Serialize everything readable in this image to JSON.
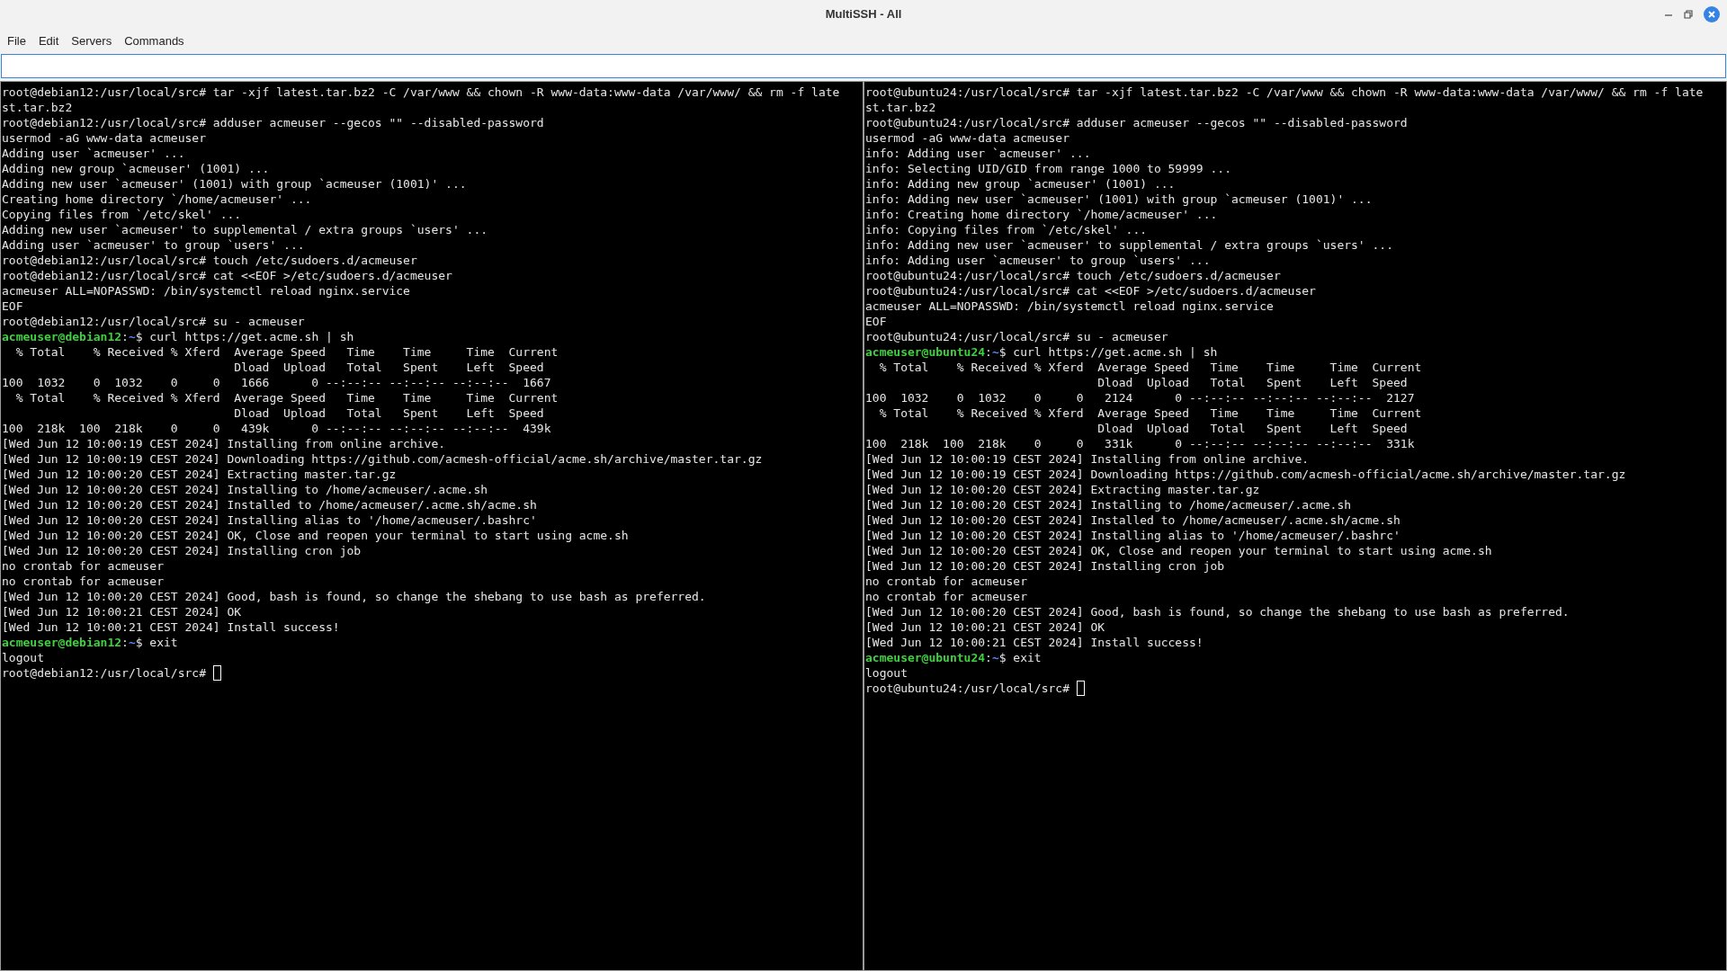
{
  "window": {
    "title": "MultiSSH - All"
  },
  "menu": [
    "File",
    "Edit",
    "Servers",
    "Commands"
  ],
  "command_input": {
    "focused": true
  },
  "panes": [
    {
      "lines": [
        {
          "kind": "output",
          "text": "root@debian12:/usr/local/src# tar -xjf latest.tar.bz2 -C /var/www && chown -R www-data:www-data /var/www/ && rm -f late"
        },
        {
          "kind": "output",
          "text": "st.tar.bz2"
        },
        {
          "kind": "output",
          "text": "root@debian12:/usr/local/src# adduser acmeuser --gecos \"\" --disabled-password"
        },
        {
          "kind": "output",
          "text": "usermod -aG www-data acmeuser"
        },
        {
          "kind": "output",
          "text": "Adding user `acmeuser' ..."
        },
        {
          "kind": "output",
          "text": "Adding new group `acmeuser' (1001) ..."
        },
        {
          "kind": "output",
          "text": "Adding new user `acmeuser' (1001) with group `acmeuser (1001)' ..."
        },
        {
          "kind": "output",
          "text": "Creating home directory `/home/acmeuser' ..."
        },
        {
          "kind": "output",
          "text": "Copying files from `/etc/skel' ..."
        },
        {
          "kind": "output",
          "text": "Adding new user `acmeuser' to supplemental / extra groups `users' ..."
        },
        {
          "kind": "output",
          "text": "Adding user `acmeuser' to group `users' ..."
        },
        {
          "kind": "output",
          "text": "root@debian12:/usr/local/src# touch /etc/sudoers.d/acmeuser"
        },
        {
          "kind": "output",
          "text": "root@debian12:/usr/local/src# cat <<EOF >/etc/sudoers.d/acmeuser"
        },
        {
          "kind": "output",
          "text": "acmeuser ALL=NOPASSWD: /bin/systemctl reload nginx.service"
        },
        {
          "kind": "output",
          "text": "EOF"
        },
        {
          "kind": "output",
          "text": "root@debian12:/usr/local/src# su - acmeuser"
        },
        {
          "kind": "user_prompt",
          "user": "acmeuser@debian12",
          "sep": ":",
          "path": "~",
          "command": "$ curl https://get.acme.sh | sh"
        },
        {
          "kind": "output",
          "text": "  % Total    % Received % Xferd  Average Speed   Time    Time     Time  Current"
        },
        {
          "kind": "output",
          "text": "                                 Dload  Upload   Total   Spent    Left  Speed"
        },
        {
          "kind": "output",
          "text": "100  1032    0  1032    0     0   1666      0 --:--:-- --:--:-- --:--:--  1667"
        },
        {
          "kind": "output",
          "text": "  % Total    % Received % Xferd  Average Speed   Time    Time     Time  Current"
        },
        {
          "kind": "output",
          "text": "                                 Dload  Upload   Total   Spent    Left  Speed"
        },
        {
          "kind": "output",
          "text": "100  218k  100  218k    0     0   439k      0 --:--:-- --:--:-- --:--:--  439k"
        },
        {
          "kind": "output",
          "text": "[Wed Jun 12 10:00:19 CEST 2024] Installing from online archive."
        },
        {
          "kind": "output",
          "text": "[Wed Jun 12 10:00:19 CEST 2024] Downloading https://github.com/acmesh-official/acme.sh/archive/master.tar.gz"
        },
        {
          "kind": "output",
          "text": "[Wed Jun 12 10:00:20 CEST 2024] Extracting master.tar.gz"
        },
        {
          "kind": "output",
          "text": "[Wed Jun 12 10:00:20 CEST 2024] Installing to /home/acmeuser/.acme.sh"
        },
        {
          "kind": "output",
          "text": "[Wed Jun 12 10:00:20 CEST 2024] Installed to /home/acmeuser/.acme.sh/acme.sh"
        },
        {
          "kind": "output",
          "text": "[Wed Jun 12 10:00:20 CEST 2024] Installing alias to '/home/acmeuser/.bashrc'"
        },
        {
          "kind": "output",
          "text": "[Wed Jun 12 10:00:20 CEST 2024] OK, Close and reopen your terminal to start using acme.sh"
        },
        {
          "kind": "output",
          "text": "[Wed Jun 12 10:00:20 CEST 2024] Installing cron job"
        },
        {
          "kind": "output",
          "text": "no crontab for acmeuser"
        },
        {
          "kind": "output",
          "text": "no crontab for acmeuser"
        },
        {
          "kind": "output",
          "text": "[Wed Jun 12 10:00:20 CEST 2024] Good, bash is found, so change the shebang to use bash as preferred."
        },
        {
          "kind": "output",
          "text": "[Wed Jun 12 10:00:21 CEST 2024] OK"
        },
        {
          "kind": "output",
          "text": "[Wed Jun 12 10:00:21 CEST 2024] Install success!"
        },
        {
          "kind": "user_prompt",
          "user": "acmeuser@debian12",
          "sep": ":",
          "path": "~",
          "command": "$ exit"
        },
        {
          "kind": "output",
          "text": "logout"
        },
        {
          "kind": "cursor_line",
          "text": "root@debian12:/usr/local/src# "
        }
      ]
    },
    {
      "lines": [
        {
          "kind": "output",
          "text": "root@ubuntu24:/usr/local/src# tar -xjf latest.tar.bz2 -C /var/www && chown -R www-data:www-data /var/www/ && rm -f late"
        },
        {
          "kind": "output",
          "text": "st.tar.bz2"
        },
        {
          "kind": "output",
          "text": "root@ubuntu24:/usr/local/src# adduser acmeuser --gecos \"\" --disabled-password"
        },
        {
          "kind": "output",
          "text": "usermod -aG www-data acmeuser"
        },
        {
          "kind": "output",
          "text": "info: Adding user `acmeuser' ..."
        },
        {
          "kind": "output",
          "text": "info: Selecting UID/GID from range 1000 to 59999 ..."
        },
        {
          "kind": "output",
          "text": "info: Adding new group `acmeuser' (1001) ..."
        },
        {
          "kind": "output",
          "text": "info: Adding new user `acmeuser' (1001) with group `acmeuser (1001)' ..."
        },
        {
          "kind": "output",
          "text": "info: Creating home directory `/home/acmeuser' ..."
        },
        {
          "kind": "output",
          "text": "info: Copying files from `/etc/skel' ..."
        },
        {
          "kind": "output",
          "text": "info: Adding new user `acmeuser' to supplemental / extra groups `users' ..."
        },
        {
          "kind": "output",
          "text": "info: Adding user `acmeuser' to group `users' ..."
        },
        {
          "kind": "output",
          "text": "root@ubuntu24:/usr/local/src# touch /etc/sudoers.d/acmeuser"
        },
        {
          "kind": "output",
          "text": "root@ubuntu24:/usr/local/src# cat <<EOF >/etc/sudoers.d/acmeuser"
        },
        {
          "kind": "output",
          "text": "acmeuser ALL=NOPASSWD: /bin/systemctl reload nginx.service"
        },
        {
          "kind": "output",
          "text": "EOF"
        },
        {
          "kind": "output",
          "text": "root@ubuntu24:/usr/local/src# su - acmeuser"
        },
        {
          "kind": "user_prompt",
          "user": "acmeuser@ubuntu24",
          "sep": ":",
          "path": "~",
          "command": "$ curl https://get.acme.sh | sh"
        },
        {
          "kind": "output",
          "text": "  % Total    % Received % Xferd  Average Speed   Time    Time     Time  Current"
        },
        {
          "kind": "output",
          "text": "                                 Dload  Upload   Total   Spent    Left  Speed"
        },
        {
          "kind": "output",
          "text": "100  1032    0  1032    0     0   2124      0 --:--:-- --:--:-- --:--:--  2127"
        },
        {
          "kind": "output",
          "text": "  % Total    % Received % Xferd  Average Speed   Time    Time     Time  Current"
        },
        {
          "kind": "output",
          "text": "                                 Dload  Upload   Total   Spent    Left  Speed"
        },
        {
          "kind": "output",
          "text": "100  218k  100  218k    0     0   331k      0 --:--:-- --:--:-- --:--:--  331k"
        },
        {
          "kind": "output",
          "text": "[Wed Jun 12 10:00:19 CEST 2024] Installing from online archive."
        },
        {
          "kind": "output",
          "text": "[Wed Jun 12 10:00:19 CEST 2024] Downloading https://github.com/acmesh-official/acme.sh/archive/master.tar.gz"
        },
        {
          "kind": "output",
          "text": "[Wed Jun 12 10:00:20 CEST 2024] Extracting master.tar.gz"
        },
        {
          "kind": "output",
          "text": "[Wed Jun 12 10:00:20 CEST 2024] Installing to /home/acmeuser/.acme.sh"
        },
        {
          "kind": "output",
          "text": "[Wed Jun 12 10:00:20 CEST 2024] Installed to /home/acmeuser/.acme.sh/acme.sh"
        },
        {
          "kind": "output",
          "text": "[Wed Jun 12 10:00:20 CEST 2024] Installing alias to '/home/acmeuser/.bashrc'"
        },
        {
          "kind": "output",
          "text": "[Wed Jun 12 10:00:20 CEST 2024] OK, Close and reopen your terminal to start using acme.sh"
        },
        {
          "kind": "output",
          "text": "[Wed Jun 12 10:00:20 CEST 2024] Installing cron job"
        },
        {
          "kind": "output",
          "text": "no crontab for acmeuser"
        },
        {
          "kind": "output",
          "text": "no crontab for acmeuser"
        },
        {
          "kind": "output",
          "text": "[Wed Jun 12 10:00:20 CEST 2024] Good, bash is found, so change the shebang to use bash as preferred."
        },
        {
          "kind": "output",
          "text": "[Wed Jun 12 10:00:21 CEST 2024] OK"
        },
        {
          "kind": "output",
          "text": "[Wed Jun 12 10:00:21 CEST 2024] Install success!"
        },
        {
          "kind": "user_prompt",
          "user": "acmeuser@ubuntu24",
          "sep": ":",
          "path": "~",
          "command": "$ exit"
        },
        {
          "kind": "output",
          "text": "logout"
        },
        {
          "kind": "cursor_line",
          "text": "root@ubuntu24:/usr/local/src# "
        }
      ]
    }
  ]
}
